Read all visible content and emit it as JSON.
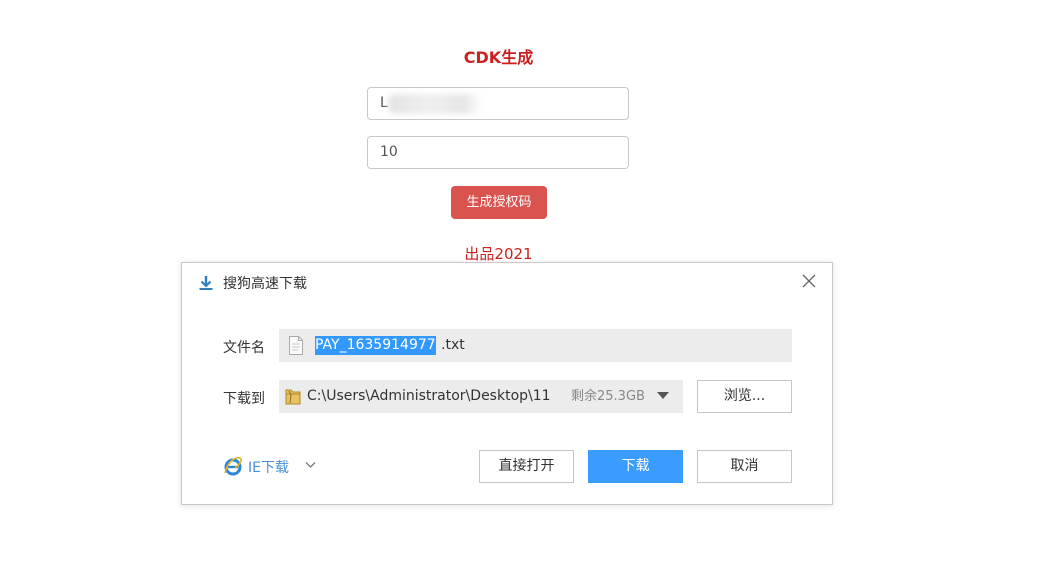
{
  "page": {
    "title": "CDK生成",
    "input1_value": "L",
    "input2_value": "10",
    "generate_button": "生成授权码",
    "footer": "出品2021"
  },
  "dialog": {
    "title": "搜狗高速下载",
    "filename_label": "文件名",
    "filename_selected": "PAY_1635914977",
    "filename_ext": ".txt",
    "download_to_label": "下载到",
    "path": "C:\\Users\\Administrator\\Desktop\\11",
    "free_space": "剩余25.3GB",
    "browse_button": "浏览...",
    "ie_download": "IE下载",
    "open_direct_button": "直接打开",
    "download_button": "下载",
    "cancel_button": "取消"
  },
  "colors": {
    "accent_red": "#cc1f1f",
    "button_red": "#d9534f",
    "primary_blue": "#3b9cff",
    "selection_blue": "#3399ff"
  },
  "icons": [
    "download-icon",
    "close-icon",
    "file-icon",
    "folder-icon",
    "dropdown-arrow-icon",
    "ie-icon",
    "chevron-down-icon"
  ]
}
